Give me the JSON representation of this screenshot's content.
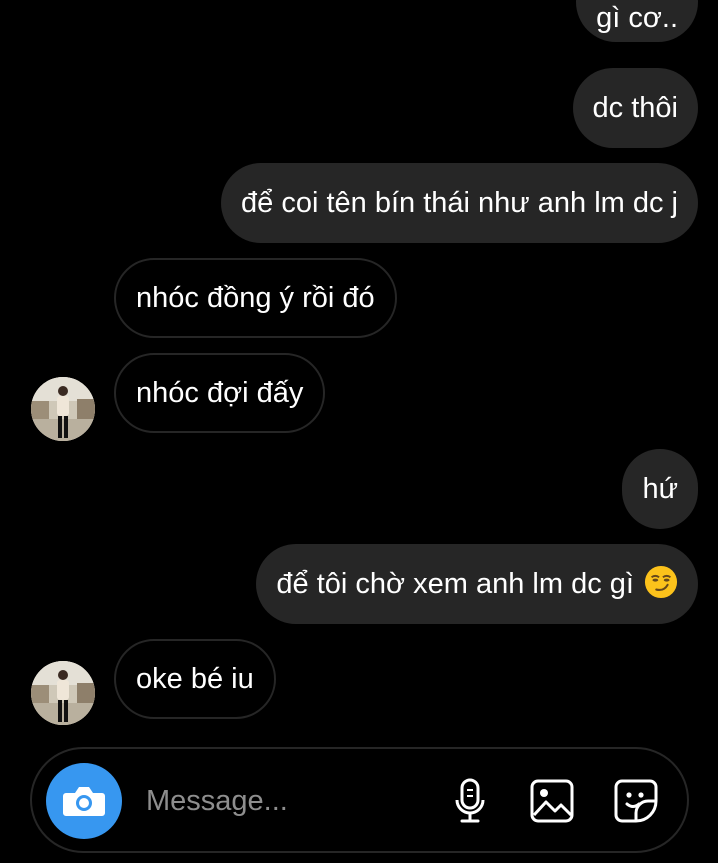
{
  "messages": [
    {
      "side": "out",
      "text": "gì cơ.."
    },
    {
      "side": "out",
      "text": "dc thôi"
    },
    {
      "side": "out",
      "text": "để coi tên bín thái như anh lm dc j"
    },
    {
      "side": "in",
      "text": "nhóc đồng ý rồi đó"
    },
    {
      "side": "in",
      "text": "nhóc đợi đấy"
    },
    {
      "side": "out",
      "text": "hứ"
    },
    {
      "side": "out",
      "text": "để tôi chờ xem anh lm dc gì",
      "emoji": "smirking-face"
    },
    {
      "side": "in",
      "text": "oke bé iu"
    }
  ],
  "composer": {
    "placeholder": "Message..."
  },
  "colors": {
    "background": "#000000",
    "outgoing_bubble": "#262626",
    "incoming_border": "#262626",
    "camera_button": "#3797f0",
    "placeholder": "#8e8e8e"
  },
  "icons": [
    "camera-icon",
    "microphone-icon",
    "gallery-icon",
    "sticker-icon",
    "smirking-face-emoji"
  ]
}
